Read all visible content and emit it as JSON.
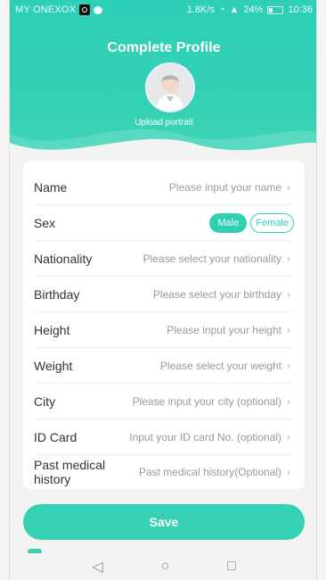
{
  "status_bar": {
    "carrier": "MY ONEXOX",
    "network_speed": "1.8K/s",
    "battery_percent": "24%",
    "time": "10:36"
  },
  "page": {
    "title": "Complete Profile",
    "upload_portrait_label": "Upload portrait"
  },
  "form": {
    "rows": [
      {
        "label": "Name",
        "value": "Please input your name"
      },
      {
        "label": "Sex",
        "options": [
          "Male",
          "Female"
        ],
        "selected": "Male"
      },
      {
        "label": "Nationality",
        "value": "Please select your nationality"
      },
      {
        "label": "Birthday",
        "value": "Please select your birthday"
      },
      {
        "label": "Height",
        "value": "Please input your height"
      },
      {
        "label": "Weight",
        "value": "Please select your weight"
      },
      {
        "label": "City",
        "value": "Please input your city (optional)"
      },
      {
        "label": "ID Card",
        "value": "Input your ID card No. (optional)"
      },
      {
        "label": "Past medical history",
        "value": "Past medical history(Optional)"
      }
    ]
  },
  "actions": {
    "save_label": "Save"
  },
  "nav_bar": {
    "back": "◁",
    "home": "○",
    "recent": "□"
  },
  "colors": {
    "accent": "#36d1b4",
    "header_gradient_top": "#2dcfb6",
    "card_bg": "#ffffff"
  }
}
